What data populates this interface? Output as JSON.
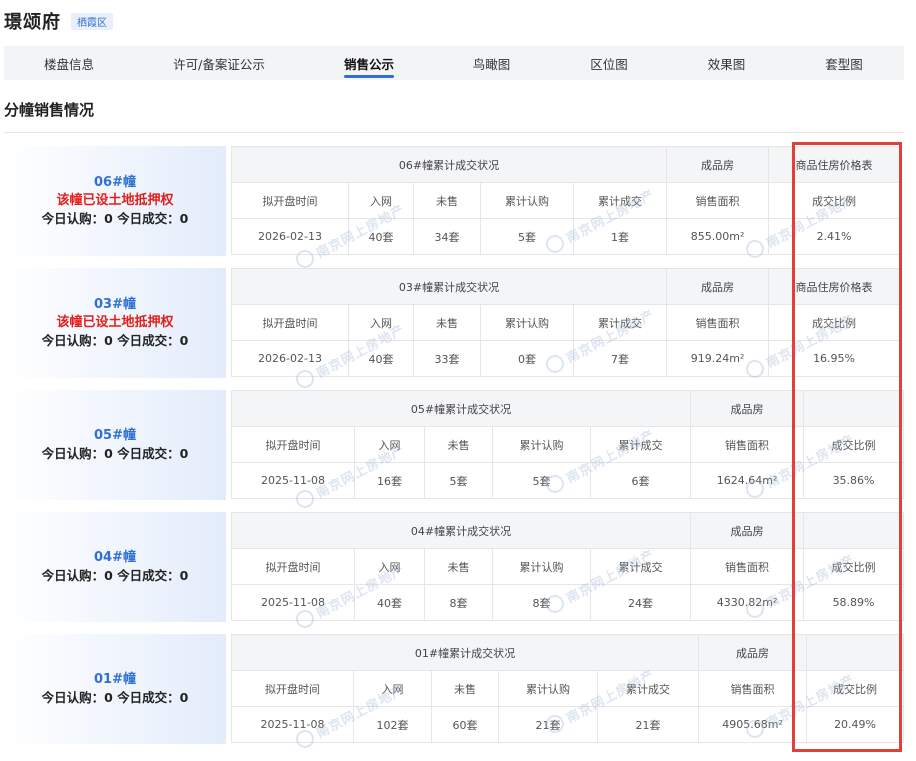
{
  "project": {
    "name": "璟颂府",
    "district": "栖霞区"
  },
  "tabs": [
    {
      "label": "楼盘信息"
    },
    {
      "label": "许可/备案证公示"
    },
    {
      "label": "销售公示"
    },
    {
      "label": "鸟瞰图"
    },
    {
      "label": "区位图"
    },
    {
      "label": "效果图"
    },
    {
      "label": "套型图"
    }
  ],
  "active_tab": "销售公示",
  "section_title": "分幢销售情况",
  "headers": {
    "finished": "成品房",
    "price_link": "商品住房价格表",
    "open_time": "拟开盘时间",
    "online": "入网",
    "unsold": "未售",
    "subscribed": "累计认购",
    "deals": "累计成交",
    "area": "销售面积",
    "ratio": "成交比例"
  },
  "watermark": "南京网上房地产",
  "buildings": [
    {
      "name": "06#幢",
      "mortgage": "该幢已设土地抵押权",
      "today": "今日认购：0 今日成交：0",
      "summary": "06#幢累计成交状况",
      "open_time": "2026-02-13",
      "online": "40套",
      "unsold": "34套",
      "subscribed": "5套",
      "deals": "1套",
      "area": "855.00m²",
      "ratio": "2.41%",
      "has_price_link": true
    },
    {
      "name": "03#幢",
      "mortgage": "该幢已设土地抵押权",
      "today": "今日认购：0 今日成交：0",
      "summary": "03#幢累计成交状况",
      "open_time": "2026-02-13",
      "online": "40套",
      "unsold": "33套",
      "subscribed": "0套",
      "deals": "7套",
      "area": "919.24m²",
      "ratio": "16.95%",
      "has_price_link": true
    },
    {
      "name": "05#幢",
      "today": "今日认购：0 今日成交：0",
      "summary": "05#幢累计成交状况",
      "open_time": "2025-11-08",
      "online": "16套",
      "unsold": "5套",
      "subscribed": "5套",
      "deals": "6套",
      "area": "1624.64m²",
      "ratio": "35.86%",
      "has_price_link": false
    },
    {
      "name": "04#幢",
      "today": "今日认购：0 今日成交：0",
      "summary": "04#幢累计成交状况",
      "open_time": "2025-11-08",
      "online": "40套",
      "unsold": "8套",
      "subscribed": "8套",
      "deals": "24套",
      "area": "4330.82m²",
      "ratio": "58.89%",
      "has_price_link": false
    },
    {
      "name": "01#幢",
      "today": "今日认购：0 今日成交：0",
      "summary": "01#幢累计成交状况",
      "open_time": "2025-11-08",
      "online": "102套",
      "unsold": "60套",
      "subscribed": "21套",
      "deals": "21套",
      "area": "4905.68m²",
      "ratio": "20.49%",
      "has_price_link": false
    }
  ],
  "colors": {
    "accent": "#2f6fd6",
    "alert": "#e0201a",
    "highlight_box": "#e0403a"
  }
}
